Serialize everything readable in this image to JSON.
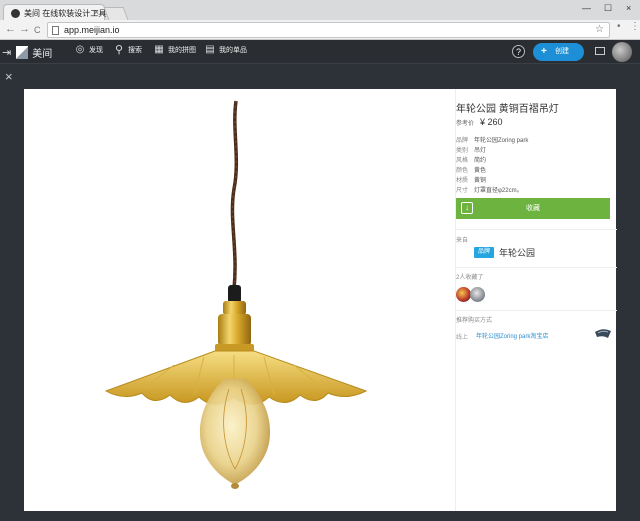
{
  "browser": {
    "tab_title": "美间 在线软装设计工具",
    "tab_close": "×",
    "url": "app.meijian.io",
    "back": "←",
    "forward": "→",
    "reload": "C",
    "star": "☆",
    "window_min": "—",
    "window_max": "☐",
    "window_close": "×"
  },
  "header": {
    "logo_text": "美间",
    "nav": [
      {
        "label": "发现",
        "icon": "compass-icon"
      },
      {
        "label": "搜索",
        "icon": "search-icon"
      },
      {
        "label": "我的拼图",
        "icon": "collage-icon"
      },
      {
        "label": "我的单品",
        "icon": "items-icon"
      }
    ],
    "help": "?",
    "create_label": "创建",
    "create_plus": "+",
    "accent": "#1c8fd6"
  },
  "overlay": {
    "close": "×"
  },
  "product": {
    "title": "年轮公园 黄铜百褶吊灯",
    "price_label": "参考价",
    "price": "¥ 260",
    "specs": [
      {
        "k": "品牌",
        "v": "年轮公园Zoring park"
      },
      {
        "k": "类别",
        "v": "吊灯"
      },
      {
        "k": "风格",
        "v": "简约"
      },
      {
        "k": "颜色",
        "v": "黄色"
      },
      {
        "k": "材质",
        "v": "黄铜"
      },
      {
        "k": "尺寸",
        "v": "灯罩直径φ22cm。"
      }
    ],
    "collect_label": "收藏",
    "collect_color": "#6db33f",
    "from_label": "来自",
    "brand_tag": "品牌",
    "brand_name": "年轮公园",
    "collected_label": "2人收藏了",
    "buy_label": "推荐购买方式",
    "buy_channel": "线上",
    "buy_link": "年轮公园Zoring park淘宝店"
  }
}
